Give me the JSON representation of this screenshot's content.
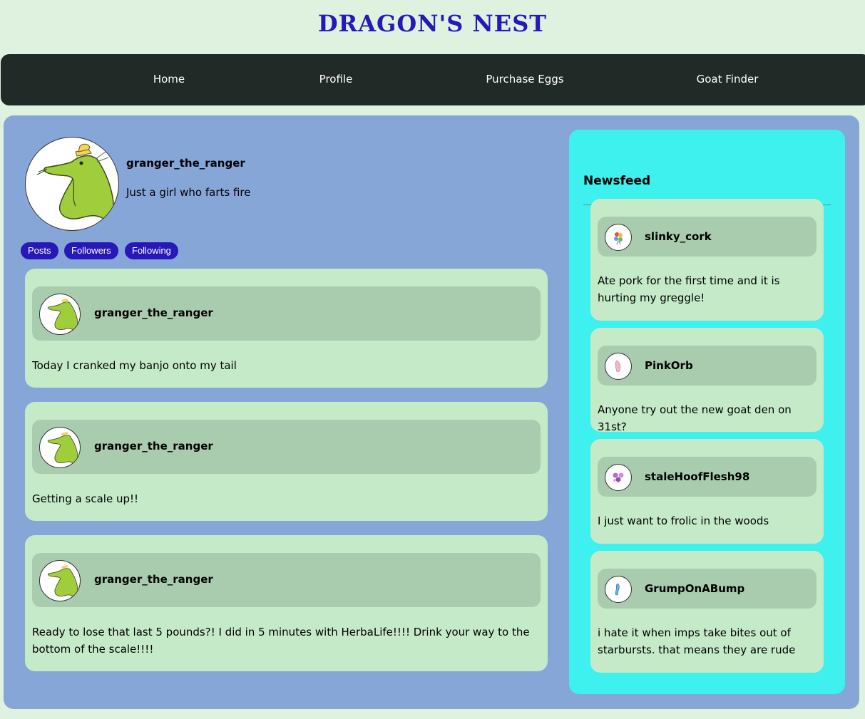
{
  "site": {
    "title": "DRAGON'S NEST"
  },
  "nav": {
    "items": [
      {
        "label": "Home"
      },
      {
        "label": "Profile"
      },
      {
        "label": "Purchase Eggs"
      },
      {
        "label": "Goat Finder"
      }
    ]
  },
  "profile": {
    "username": "granger_the_ranger",
    "bio": "Just a girl who farts fire",
    "avatar_icon": "green-dragon-with-hat",
    "tabs": [
      {
        "label": "Posts"
      },
      {
        "label": "Followers"
      },
      {
        "label": "Following"
      }
    ]
  },
  "posts": [
    {
      "user": "granger_the_ranger",
      "text": "Today I cranked my banjo onto my tail",
      "avatar_icon": "green-dragon-icon"
    },
    {
      "user": "granger_the_ranger",
      "text": "Getting a scale up!!",
      "avatar_icon": "green-dragon-icon"
    },
    {
      "user": "granger_the_ranger",
      "text": "Ready to lose that last 5 pounds?! I did in 5 minutes with HerbaLife!!!! Drink your way to the bottom of the scale!!!!",
      "avatar_icon": "green-dragon-icon"
    }
  ],
  "newsfeed": {
    "title": "Newsfeed",
    "items": [
      {
        "user": "slinky_cork",
        "text": "Ate pork for the first time and it is hurting my greggle!",
        "avatar_icon": "rainbow-creature-icon"
      },
      {
        "user": "PinkOrb",
        "text": "Anyone try out the new goat den on 31st?",
        "avatar_icon": "pink-creature-icon"
      },
      {
        "user": "staleHoofFlesh98",
        "text": "I just want to frolic in the woods",
        "avatar_icon": "purple-creature-icon"
      },
      {
        "user": "GrumpOnABump",
        "text": "i hate it when imps take bites out of starbursts. that means they are rude",
        "avatar_icon": "blue-creature-icon"
      }
    ]
  },
  "colors": {
    "title": "#2718b8",
    "navbar": "#212a26",
    "panel": "#86a6d8",
    "card": "#c5eac8",
    "card_header": "#a9cbae",
    "newsfeed": "#3ef0ee",
    "pill": "#2718b8"
  }
}
